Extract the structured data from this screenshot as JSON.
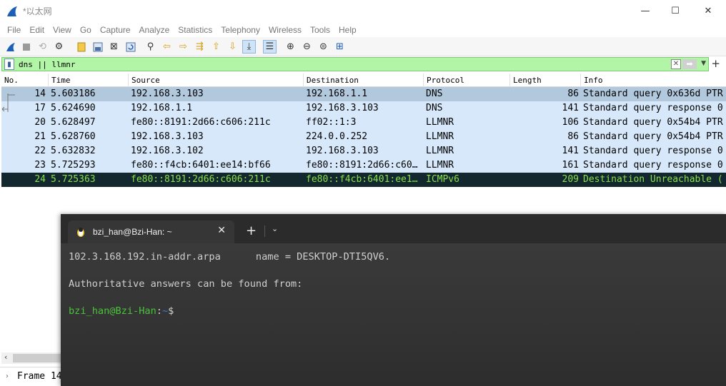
{
  "window": {
    "title": "*以太网",
    "controls": {
      "minimize": "—",
      "maximize": "☐",
      "close": "✕"
    }
  },
  "menu": [
    "File",
    "Edit",
    "View",
    "Go",
    "Capture",
    "Analyze",
    "Statistics",
    "Telephony",
    "Wireless",
    "Tools",
    "Help"
  ],
  "toolbar": {
    "icons": [
      "start-capture-icon",
      "stop-capture-icon",
      "restart-capture-icon",
      "capture-options-icon",
      "open-file-icon",
      "save-file-icon",
      "close-file-icon",
      "reload-file-icon",
      "find-packet-icon",
      "go-back-icon",
      "go-forward-icon",
      "go-to-packet-icon",
      "go-first-icon",
      "go-last-icon",
      "autoscroll-icon",
      "colorize-icon",
      "zoom-in-icon",
      "zoom-out-icon",
      "normal-size-icon",
      "resize-columns-icon"
    ]
  },
  "filter": {
    "value": "dns || llmnr"
  },
  "columns": {
    "no": "No.",
    "time": "Time",
    "source": "Source",
    "destination": "Destination",
    "protocol": "Protocol",
    "length": "Length",
    "info": "Info"
  },
  "packets": [
    {
      "no": "14",
      "time": "5.603186",
      "source": "192.168.3.103",
      "destination": "192.168.1.1",
      "protocol": "DNS",
      "length": "86",
      "info": "Standard query 0x636d PTR",
      "state": "selected"
    },
    {
      "no": "17",
      "time": "5.624690",
      "source": "192.168.1.1",
      "destination": "192.168.3.103",
      "protocol": "DNS",
      "length": "141",
      "info": "Standard query response 0",
      "state": "normal"
    },
    {
      "no": "20",
      "time": "5.628497",
      "source": "fe80::8191:2d66:c606:211c",
      "destination": "ff02::1:3",
      "protocol": "LLMNR",
      "length": "106",
      "info": "Standard query 0x54b4 PTR",
      "state": "normal"
    },
    {
      "no": "21",
      "time": "5.628760",
      "source": "192.168.3.103",
      "destination": "224.0.0.252",
      "protocol": "LLMNR",
      "length": "86",
      "info": "Standard query 0x54b4 PTR",
      "state": "normal"
    },
    {
      "no": "22",
      "time": "5.632832",
      "source": "192.168.3.102",
      "destination": "192.168.3.103",
      "protocol": "LLMNR",
      "length": "141",
      "info": "Standard query response 0",
      "state": "normal"
    },
    {
      "no": "23",
      "time": "5.725293",
      "source": "fe80::f4cb:6401:ee14:bf66",
      "destination": "fe80::8191:2d66:c60…",
      "protocol": "LLMNR",
      "length": "161",
      "info": "Standard query response 0",
      "state": "normal"
    },
    {
      "no": "24",
      "time": "5.725363",
      "source": "fe80::8191:2d66:c606:211c",
      "destination": "fe80::f4cb:6401:ee1…",
      "protocol": "ICMPv6",
      "length": "209",
      "info": "Destination Unreachable (",
      "state": "error"
    }
  ],
  "detail": {
    "line": "Frame 14"
  },
  "terminal": {
    "tab_title": "bzi_han@Bzi-Han: ~",
    "lines": [
      "102.3.168.192.in-addr.arpa      name = DESKTOP-DTI5QV6.",
      "Authoritative answers can be found from:"
    ],
    "prompt": {
      "user": "bzi_han@Bzi-Han",
      "sep": ":",
      "path": "~",
      "symbol": "$"
    }
  },
  "colors": {
    "selected_row": "#b2c8dc",
    "row_bg": "#d7e8fa",
    "error_bg": "#12272e",
    "error_fg": "#8ae04a",
    "filter_bg": "#b2f5a6",
    "prompt_green": "#4bc23b",
    "prompt_blue": "#3c7be0"
  }
}
